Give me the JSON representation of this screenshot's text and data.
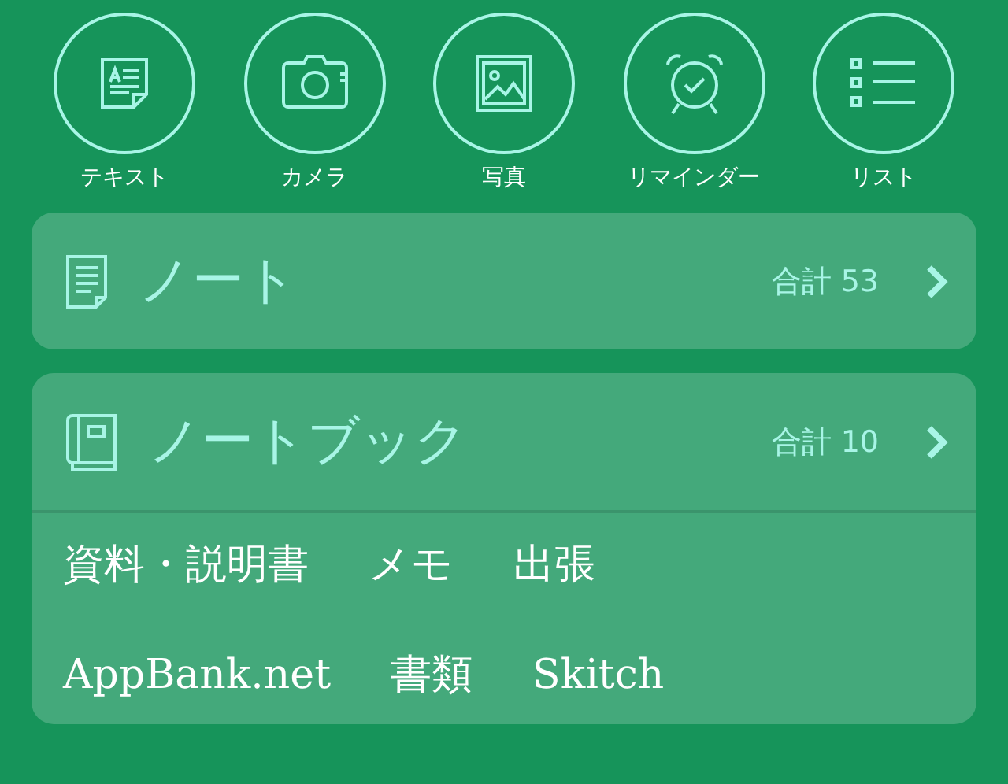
{
  "quick_actions": [
    {
      "kind": "text",
      "label": "テキスト"
    },
    {
      "kind": "camera",
      "label": "カメラ"
    },
    {
      "kind": "photo",
      "label": "写真"
    },
    {
      "kind": "reminder",
      "label": "リマインダー"
    },
    {
      "kind": "list",
      "label": "リスト"
    }
  ],
  "notes": {
    "title": "ノート",
    "count": "合計 53"
  },
  "notebooks": {
    "title": "ノートブック",
    "count": "合計 10",
    "rows": [
      [
        "資料・説明書",
        "メモ",
        "出張"
      ],
      [
        "AppBank.net",
        "書類",
        "Skitch"
      ]
    ]
  }
}
